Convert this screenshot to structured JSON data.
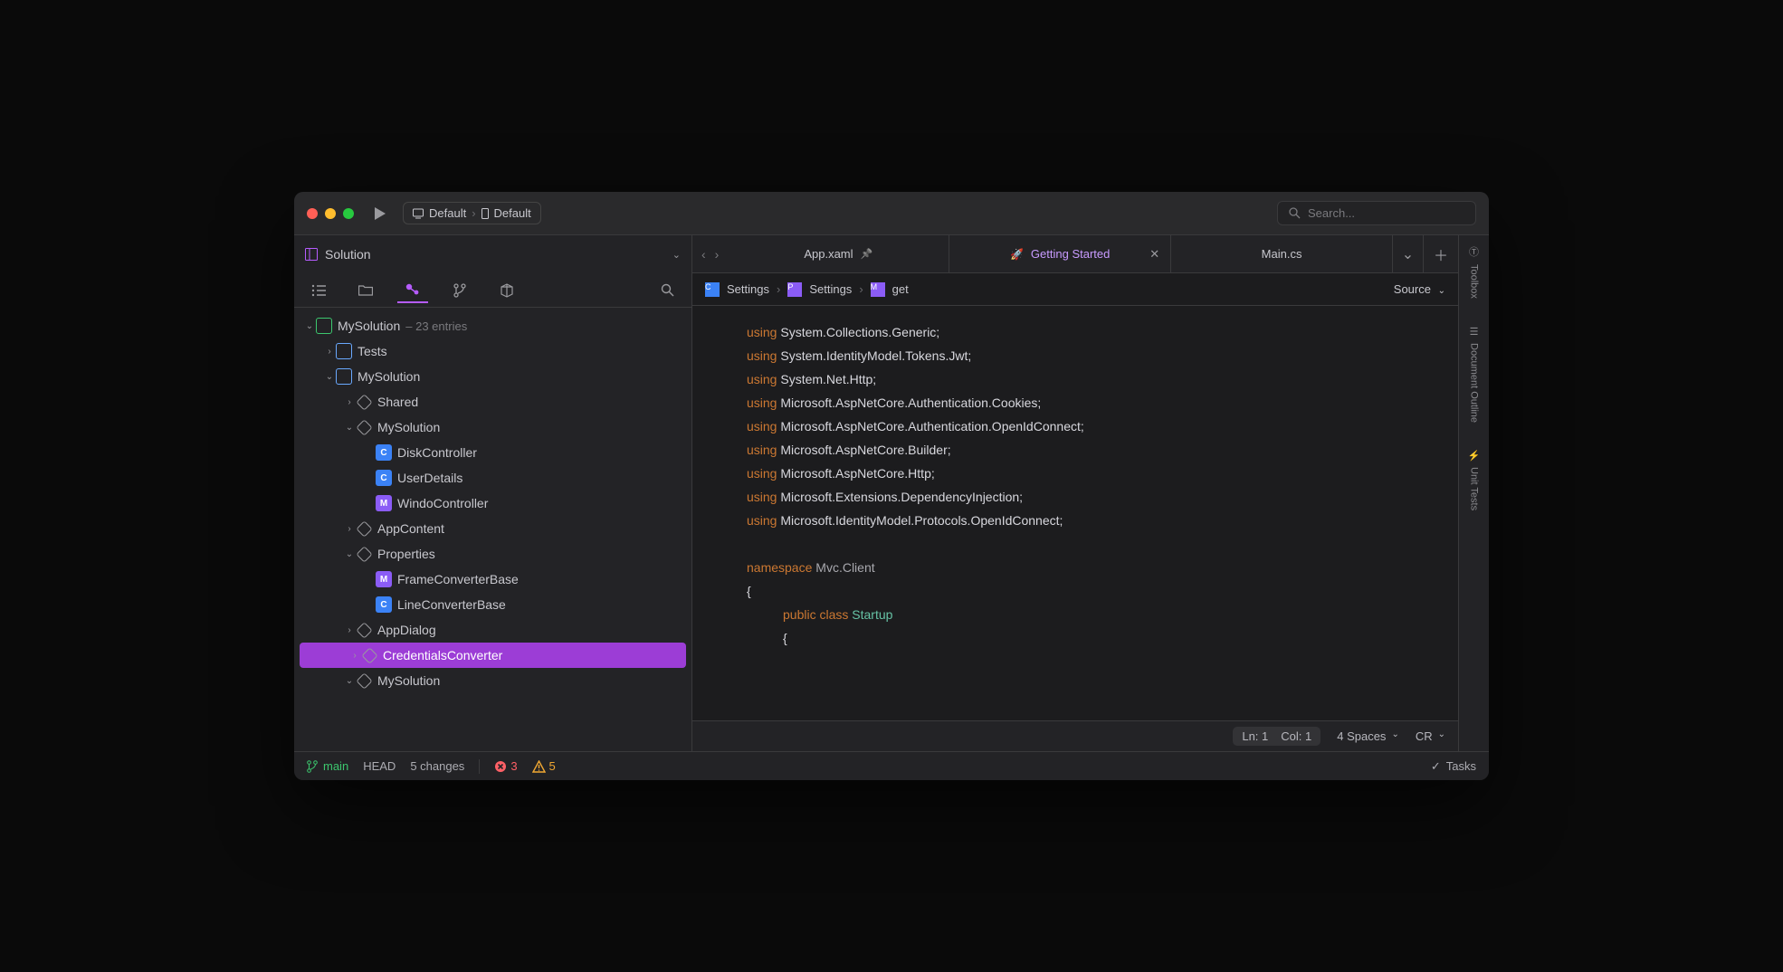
{
  "titlebar": {
    "run_target_1": "Default",
    "run_target_2": "Default",
    "search_placeholder": "Search..."
  },
  "sidebar": {
    "title": "Solution",
    "solution_name": "MySolution",
    "solution_hint": "– 23 entries",
    "tree": [
      {
        "depth": 1,
        "chev": "›",
        "icon": "proj",
        "label": "Tests"
      },
      {
        "depth": 1,
        "chev": "⌄",
        "icon": "proj",
        "label": "MySolution"
      },
      {
        "depth": 2,
        "chev": "›",
        "icon": "folder",
        "label": "Shared"
      },
      {
        "depth": 2,
        "chev": "⌄",
        "icon": "folder",
        "label": "MySolution"
      },
      {
        "depth": 3,
        "chev": "",
        "icon": "cs",
        "iconText": "C",
        "label": "DiskController"
      },
      {
        "depth": 3,
        "chev": "",
        "icon": "cs",
        "iconText": "C",
        "label": "UserDetails"
      },
      {
        "depth": 3,
        "chev": "",
        "icon": "xaml",
        "iconText": "M",
        "label": "WindoController"
      },
      {
        "depth": 2,
        "chev": "›",
        "icon": "folder",
        "label": "AppContent"
      },
      {
        "depth": 2,
        "chev": "⌄",
        "icon": "folder",
        "label": "Properties"
      },
      {
        "depth": 3,
        "chev": "",
        "icon": "xaml",
        "iconText": "M",
        "label": "FrameConverterBase"
      },
      {
        "depth": 3,
        "chev": "",
        "icon": "cs",
        "iconText": "C",
        "label": "LineConverterBase"
      },
      {
        "depth": 2,
        "chev": "›",
        "icon": "folder",
        "label": "AppDialog"
      },
      {
        "depth": 2,
        "chev": "›",
        "icon": "folder",
        "label": "CredentialsConverter",
        "selected": true
      },
      {
        "depth": 2,
        "chev": "⌄",
        "icon": "folder",
        "label": "MySolution"
      }
    ]
  },
  "tabs": {
    "items": [
      {
        "label": "App.xaml",
        "pinned": true
      },
      {
        "label": "Getting Started",
        "highlight": true,
        "closable": true
      },
      {
        "label": "Main.cs"
      }
    ]
  },
  "breadcrumb": {
    "items": [
      {
        "icon": "cs",
        "iconText": "C",
        "label": "Settings"
      },
      {
        "icon": "xaml",
        "iconText": "P",
        "label": "Settings"
      },
      {
        "icon": "xaml",
        "iconText": "M",
        "label": "get"
      }
    ],
    "source_label": "Source"
  },
  "code_lines": [
    {
      "t": "using",
      "rest": " System.Collections.Generic;"
    },
    {
      "t": "using",
      "rest": " System.IdentityModel.Tokens.Jwt;"
    },
    {
      "t": "using",
      "rest": " System.Net.Http;"
    },
    {
      "t": "using",
      "rest": " Microsoft.AspNetCore.Authentication.Cookies;"
    },
    {
      "t": "using",
      "rest": " Microsoft.AspNetCore.Authentication.OpenIdConnect;"
    },
    {
      "t": "using",
      "rest": " Microsoft.AspNetCore.Builder;"
    },
    {
      "t": "using",
      "rest": " Microsoft.AspNetCore.Http;"
    },
    {
      "t": "using",
      "rest": " Microsoft.Extensions.DependencyInjection;"
    },
    {
      "t": "using",
      "rest": " Microsoft.IdentityModel.Protocols.OpenIdConnect;"
    }
  ],
  "code_ns": {
    "kw": "namespace",
    "name": "Mvc.Client"
  },
  "code_class": {
    "kw1": "public",
    "kw2": "class",
    "name": "Startup"
  },
  "editor_footer": {
    "line": "Ln: 1",
    "col": "Col: 1",
    "indent": "4 Spaces",
    "lineending": "CR"
  },
  "rail": {
    "toolbox": "Toolbox",
    "outline": "Document Outline",
    "unit": "Unit Tests"
  },
  "status": {
    "branch": "main",
    "head": "HEAD",
    "changes": "5 changes",
    "errors": "3",
    "warnings": "5",
    "tasks": "Tasks"
  }
}
